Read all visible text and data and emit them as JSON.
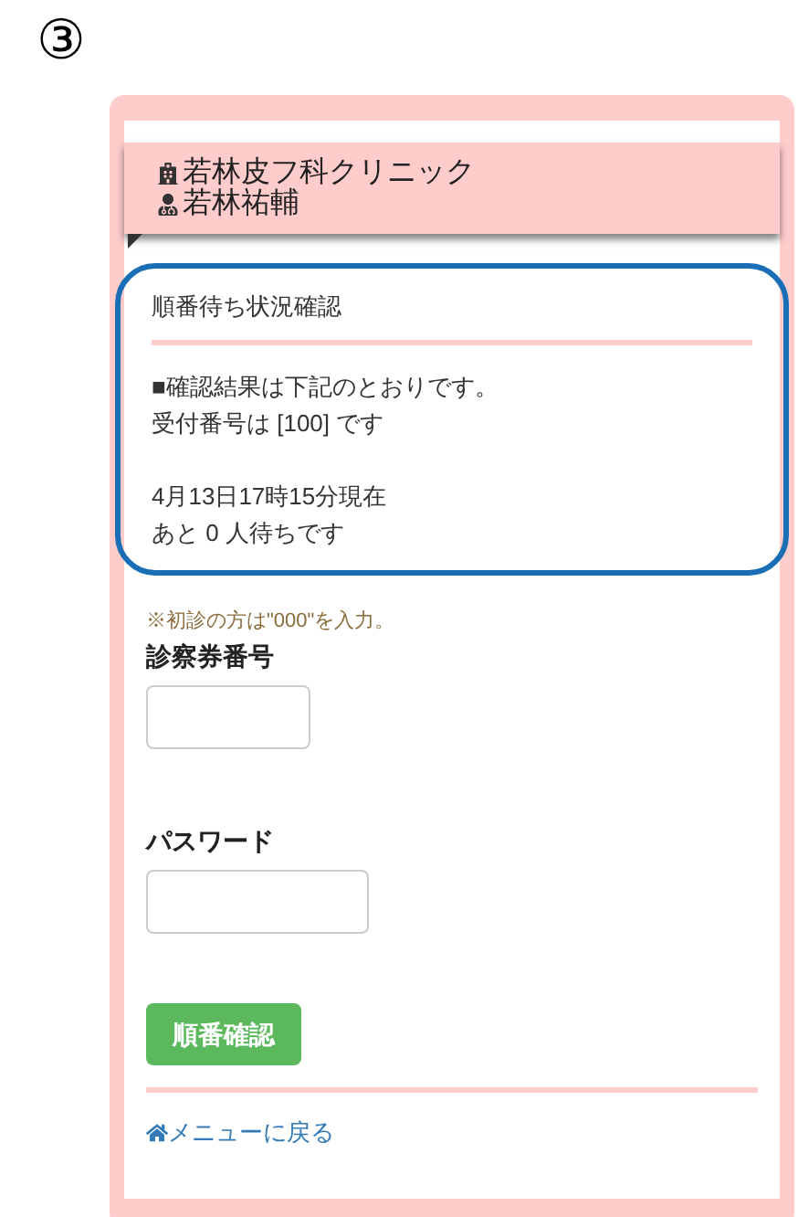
{
  "step_label": "③",
  "header": {
    "clinic": "若林皮フ科クリニック",
    "doctor": "若林祐輔"
  },
  "status_box": {
    "title": "順番待ち状況確認",
    "paragraphs": [
      [
        "■確認結果は下記のとおりです。",
        "受付番号は [100] です"
      ],
      [
        "4月13日17時15分現在",
        "あと 0 人待ちです"
      ]
    ]
  },
  "note": "※初診の方は\"000\"を入力。",
  "fields": [
    {
      "label": "診察券番号",
      "kind": "short"
    },
    {
      "label": "パスワード",
      "kind": "long"
    }
  ],
  "submit_button": "順番確認",
  "back_link": "メニューに戻る"
}
